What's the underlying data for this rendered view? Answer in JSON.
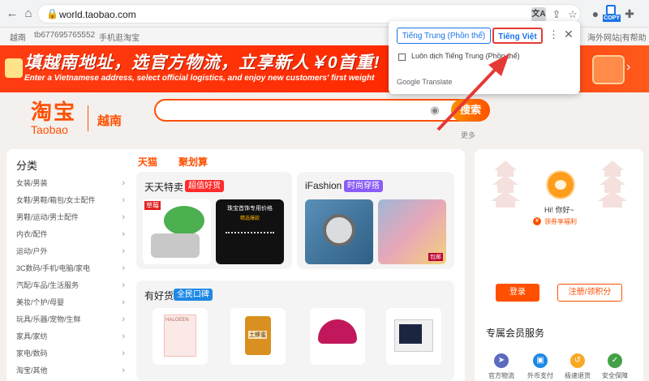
{
  "browser": {
    "url": "world.taobao.com",
    "translate_icon_text": "文A",
    "copy_label": "COPY"
  },
  "topbar": {
    "location": "越南",
    "user_id": "tb677695765552",
    "mobile": "手机逛淘宝",
    "right_text": "海外网站|有帮助"
  },
  "banner": {
    "headline": "填越南地址，选官方物流，立享新人￥0首重!",
    "subline": "Enter a Vietnamese address, select official logistics, and enjoy new customers' first weight"
  },
  "header": {
    "logo_cn": "淘宝",
    "logo_en": "Taobao",
    "region": "越南",
    "search_button": "搜索",
    "more_link": "更多"
  },
  "categories": {
    "title": "分类",
    "items": [
      "女装/男装",
      "女鞋/男鞋/箱包/女士配件",
      "男鞋/运动/男士配件",
      "内衣/配件",
      "运动/户外",
      "3C数码/手机/电脑/家电",
      "汽配/车品/生活服务",
      "美妆/个护/母婴",
      "玩具/乐器/宠物/生鲜",
      "家具/家纺",
      "家电/数码",
      "淘宝/其他"
    ]
  },
  "tabs": {
    "tmall": "天猫",
    "juhuasuan": "聚划算"
  },
  "tiles": {
    "daily": {
      "title": "天天特卖",
      "badge": "超值好货",
      "promo_label": "草莓",
      "promo_text": "珠宝首饰专用价格",
      "promo_sub": "精选爆款"
    },
    "ifashion": {
      "title": "iFashion",
      "badge": "时尚穿搭",
      "brand_label": "包邮"
    },
    "goods": {
      "title": "有好货",
      "badge": "全民口碑",
      "honey_label": "土蜂蜜",
      "halo_label": "HALOEEN"
    }
  },
  "sidebar": {
    "greeting": "Hi! 你好~",
    "coin_text": "领券享福利",
    "login": "登录",
    "register": "注册/领积分",
    "member_title": "专属会员服务",
    "services": [
      "官方物流",
      "外币支付",
      "极速退货",
      "安全保障"
    ]
  },
  "translate_popup": {
    "source_lang": "Tiếng Trung (Phồn thể)",
    "target_lang": "Tiếng Việt",
    "always_translate": "Luôn dịch Tiếng Trung (Phồn thể)",
    "brand": "Google Translate"
  },
  "colors": {
    "taobao_orange": "#ff5000",
    "translate_blue": "#1a73e8",
    "highlight_red": "#e53935"
  }
}
